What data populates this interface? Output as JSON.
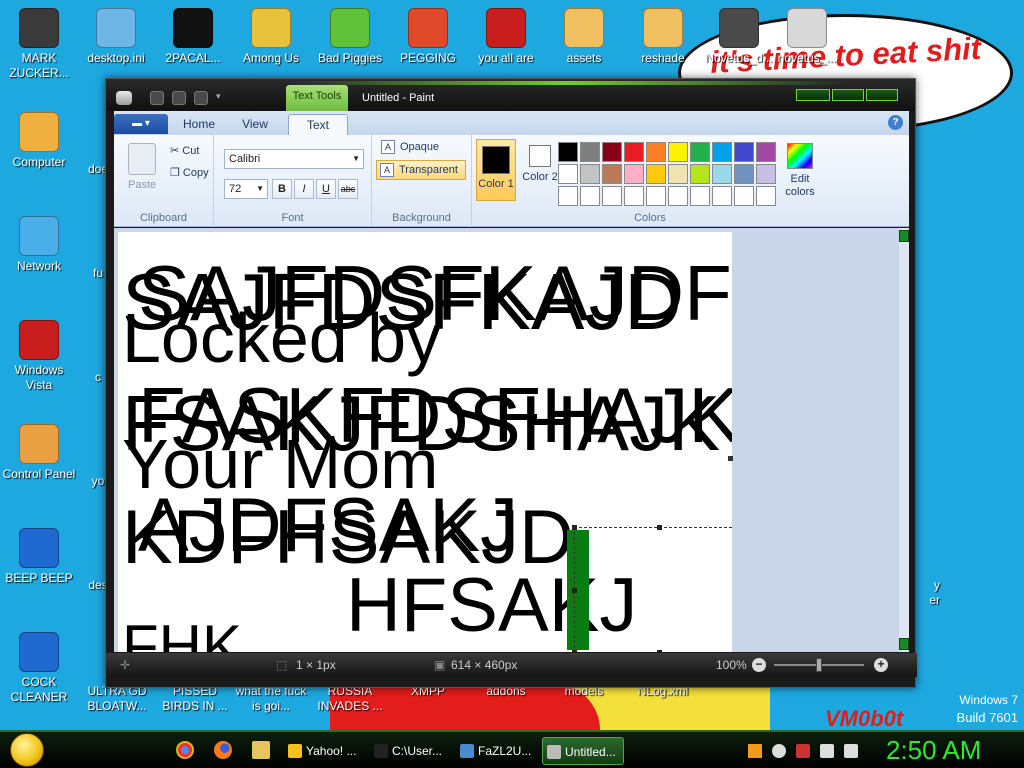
{
  "desktop": {
    "bubble_text": "it's time to eat shit new",
    "watermark": "VM0b0t",
    "os_name": "Windows 7",
    "os_build": "Build 7601",
    "icons_top": [
      {
        "label": "MARK ZUCKER...",
        "icon": "user-silhouette-icon",
        "color": "#3a3a3a"
      },
      {
        "label": "desktop.ini",
        "icon": "settings-file-icon",
        "color": "#6fb6e8"
      },
      {
        "label": "2PACAL...",
        "icon": "cmd-window-icon",
        "color": "#111111"
      },
      {
        "label": "Among Us",
        "icon": "among-us-icon",
        "color": "#e8c23a"
      },
      {
        "label": "Bad Piggies",
        "icon": "bad-piggies-icon",
        "color": "#5fc23a"
      },
      {
        "label": "PEGGING",
        "icon": "peggle-icon",
        "color": "#e04a2a"
      },
      {
        "label": "you all are",
        "icon": "devcpp-icon",
        "color": "#c81e1e"
      },
      {
        "label": "assets",
        "icon": "folder-icon",
        "color": "#f0c060"
      },
      {
        "label": "reshade",
        "icon": "folder-icon",
        "color": "#f0c060"
      },
      {
        "label": "Novetus_d...",
        "icon": "novetus-icon",
        "color": "#4a4a4a"
      },
      {
        "label": "novetus_...",
        "icon": "novetus-icon",
        "color": "#d8d8d8"
      }
    ],
    "icons_left": [
      {
        "label": "Computer",
        "icon": "computer-icon",
        "color": "#f0b040"
      },
      {
        "label": "Network",
        "icon": "network-icon",
        "color": "#4aaee8"
      },
      {
        "label": "Windows Vista",
        "icon": "recycle-bin-icon",
        "color": "#c81e1e"
      },
      {
        "label": "Control Panel",
        "icon": "control-panel-icon",
        "color": "#e8a040"
      },
      {
        "label": "BEEP BEEP",
        "icon": "blue-book-icon",
        "color": "#1e6ad0"
      },
      {
        "label": "COCK CLEANER",
        "icon": "blue-book-icon",
        "color": "#1e6ad0"
      }
    ],
    "icons_partial": [
      {
        "label": "doe"
      },
      {
        "label": "fu"
      },
      {
        "label": "c"
      },
      {
        "label": "yo"
      },
      {
        "label": "des"
      }
    ],
    "icons_bottom": [
      {
        "label": "ULTRA GD BLOATW..."
      },
      {
        "label": "PISSED BIRDS IN ..."
      },
      {
        "label": "what the fuck is goi..."
      },
      {
        "label": "RUSSIA INVADES ..."
      },
      {
        "label": "XMPP"
      },
      {
        "label": "addons"
      },
      {
        "label": "models"
      },
      {
        "label": "NLog.xml"
      }
    ],
    "right_partial": [
      "y",
      "er"
    ]
  },
  "paint": {
    "title": "Untitled - Paint",
    "context_tab": "Text Tools",
    "tabs": {
      "file": "▾",
      "home": "Home",
      "view": "View",
      "text": "Text"
    },
    "help": "?",
    "clipboard": {
      "paste": "Paste",
      "cut": "Cut",
      "copy": "Copy",
      "label": "Clipboard"
    },
    "font": {
      "family": "Calibri",
      "size": "72",
      "bold": "B",
      "italic": "I",
      "underline": "U",
      "strike": "abc",
      "label": "Font"
    },
    "background": {
      "opaque": "Opaque",
      "transparent": "Transparent",
      "label": "Background"
    },
    "colors": {
      "color1": "Color 1",
      "color1_value": "#000000",
      "color2": "Color 2",
      "color2_value": "#ffffff",
      "edit": "Edit colors",
      "label": "Colors",
      "palette": [
        "#000000",
        "#7f7f7f",
        "#880015",
        "#ed1c24",
        "#ff7f27",
        "#fff200",
        "#22b14c",
        "#00a2e8",
        "#3f48cc",
        "#a349a4",
        "#ffffff",
        "#c3c3c3",
        "#b97a57",
        "#ffaec9",
        "#ffc90e",
        "#efe4b0",
        "#b5e61d",
        "#99d9ea",
        "#7092be",
        "#c8bfe7",
        "#ffffff",
        "#ffffff",
        "#ffffff",
        "#ffffff",
        "#ffffff",
        "#ffffff",
        "#ffffff",
        "#ffffff",
        "#ffffff",
        "#ffffff"
      ]
    },
    "canvas_text": [
      "SAJFDSFKAJDFJD",
      "SAJFDSFKAJD",
      "Locked by",
      "FASKFDSFHAJK",
      "FSAKJFDSHAJK",
      "Your Mom",
      "AJDFSAKJ",
      "KDFHSAKJD",
      "HFSAKJ",
      "FHK"
    ],
    "status": {
      "cursor": "1 × 1px",
      "size": "614 × 460px",
      "zoom": "100%"
    },
    "selection_fill": "#0a7d12"
  },
  "taskbar": {
    "buttons": [
      {
        "label": "Yahoo! ...",
        "icon": "yahoo-icon",
        "color": "#f5c21a"
      },
      {
        "label": "C:\\User...",
        "icon": "7zip-icon",
        "color": "#222222"
      },
      {
        "label": "FaZL2U...",
        "icon": "image-viewer-icon",
        "color": "#4a8ad0"
      },
      {
        "label": "Untitled...",
        "icon": "paint-icon",
        "color": "#bbbbbb"
      }
    ],
    "clock": "2:50 AM"
  }
}
